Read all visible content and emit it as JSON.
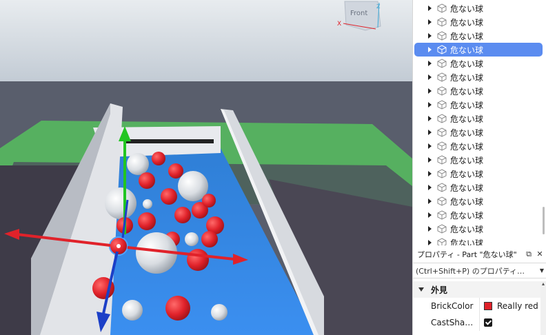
{
  "viewport": {
    "view_cube_label": "Front",
    "axis_x_label": "X",
    "axis_z_label": "Z"
  },
  "explorer": {
    "items": [
      {
        "label": "危ない球",
        "selected": false
      },
      {
        "label": "危ない球",
        "selected": false
      },
      {
        "label": "危ない球",
        "selected": false
      },
      {
        "label": "危ない球",
        "selected": true
      },
      {
        "label": "危ない球",
        "selected": false
      },
      {
        "label": "危ない球",
        "selected": false
      },
      {
        "label": "危ない球",
        "selected": false
      },
      {
        "label": "危ない球",
        "selected": false
      },
      {
        "label": "危ない球",
        "selected": false
      },
      {
        "label": "危ない球",
        "selected": false
      },
      {
        "label": "危ない球",
        "selected": false
      },
      {
        "label": "危ない球",
        "selected": false
      },
      {
        "label": "危ない球",
        "selected": false
      },
      {
        "label": "危ない球",
        "selected": false
      },
      {
        "label": "危ない球",
        "selected": false
      },
      {
        "label": "危ない球",
        "selected": false
      },
      {
        "label": "危ない球",
        "selected": false
      },
      {
        "label": "危ない球",
        "selected": false
      }
    ]
  },
  "properties": {
    "title": "プロパティ - Part \"危ない球\"",
    "filter_placeholder": "(Ctrl+Shift+P) のプロパティ…",
    "section": "外見",
    "rows": [
      {
        "name": "BrickColor",
        "value": "Really red",
        "color": "#e0222a"
      },
      {
        "name": "CastSha…",
        "checked": true
      }
    ]
  },
  "colors": {
    "selection": "#5b8cf0",
    "ball_red": "#e0222a",
    "ground_green": "#56b060"
  }
}
